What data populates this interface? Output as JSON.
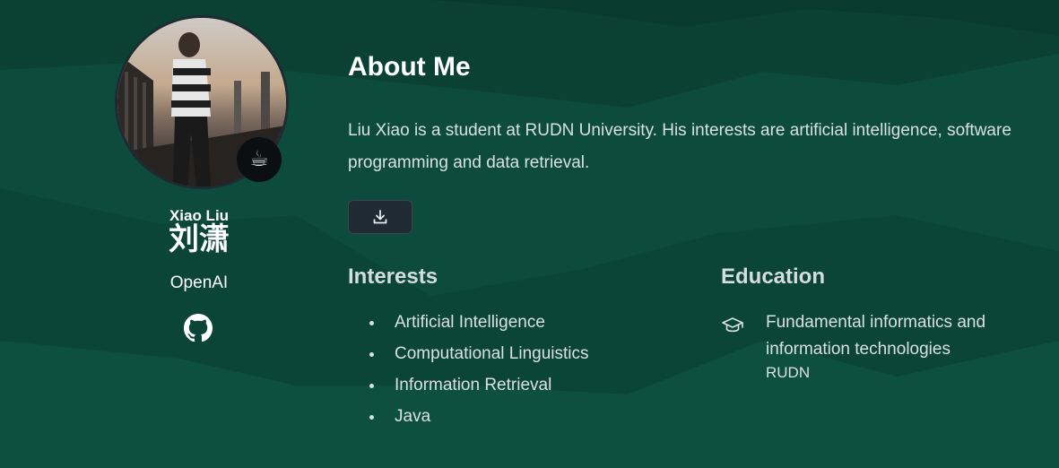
{
  "profile": {
    "name_en": "Xiao Liu",
    "name_zh": "刘潇",
    "organization": "OpenAI",
    "badge_emoji": "☕",
    "social_icon": "github-icon"
  },
  "about": {
    "title": "About Me",
    "bio": "Liu Xiao is a student at RUDN University. His interests are artificial intelligence, software programming and data retrieval.",
    "download_icon": "download-icon"
  },
  "interests": {
    "heading": "Interests",
    "items": [
      "Artificial Intelligence",
      "Computational Linguistics",
      "Information Retrieval",
      "Java"
    ]
  },
  "education": {
    "heading": "Education",
    "icon": "graduation-cap-icon",
    "course": "Fundamental informatics and information technologies",
    "institution": "RUDN"
  },
  "colors": {
    "background": "#0c4a3b",
    "background_dark": "#073a2d",
    "button_bg": "#202a33",
    "text": "#d9e0e3",
    "heading": "#ffffff"
  }
}
